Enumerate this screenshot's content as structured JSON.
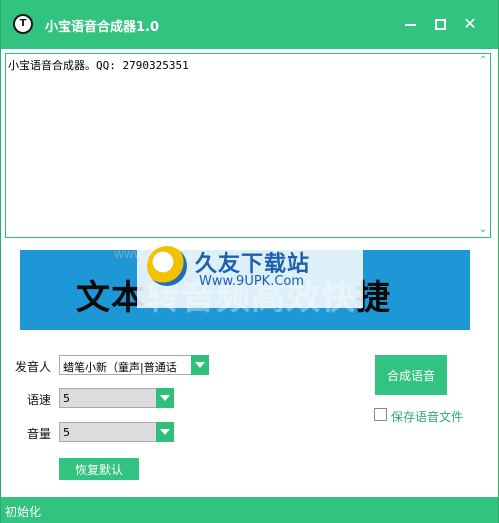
{
  "window": {
    "title": "小宝语音合成器1.0",
    "icon": "T",
    "controls": {
      "minimize": "minimize-icon",
      "maximize": "maximize-icon",
      "close": "✕"
    }
  },
  "editor": {
    "text": "小宝语音合成器。QQ: 2790325351"
  },
  "banner": {
    "text_part1": "文本",
    "text_part2": "转音频高效快",
    "text_part3": "捷"
  },
  "watermark": {
    "title": "久友下载站",
    "url": "Www.9UPK.Com",
    "left_text": "WWW.9UPK.COM"
  },
  "form": {
    "voice_label": "发音人",
    "voice_value": "蜡笔小新（童声|普通话",
    "speed_label": "语速",
    "speed_value": "5",
    "volume_label": "音量",
    "volume_value": "5",
    "reset_button": "恢复默认",
    "synthesize_button": "合成语音",
    "save_checkbox_label": "保存语音文件",
    "save_checked": false
  },
  "status": {
    "text": "初始化"
  },
  "colors": {
    "accent": "#33c381",
    "banner": "#1e97d6"
  }
}
